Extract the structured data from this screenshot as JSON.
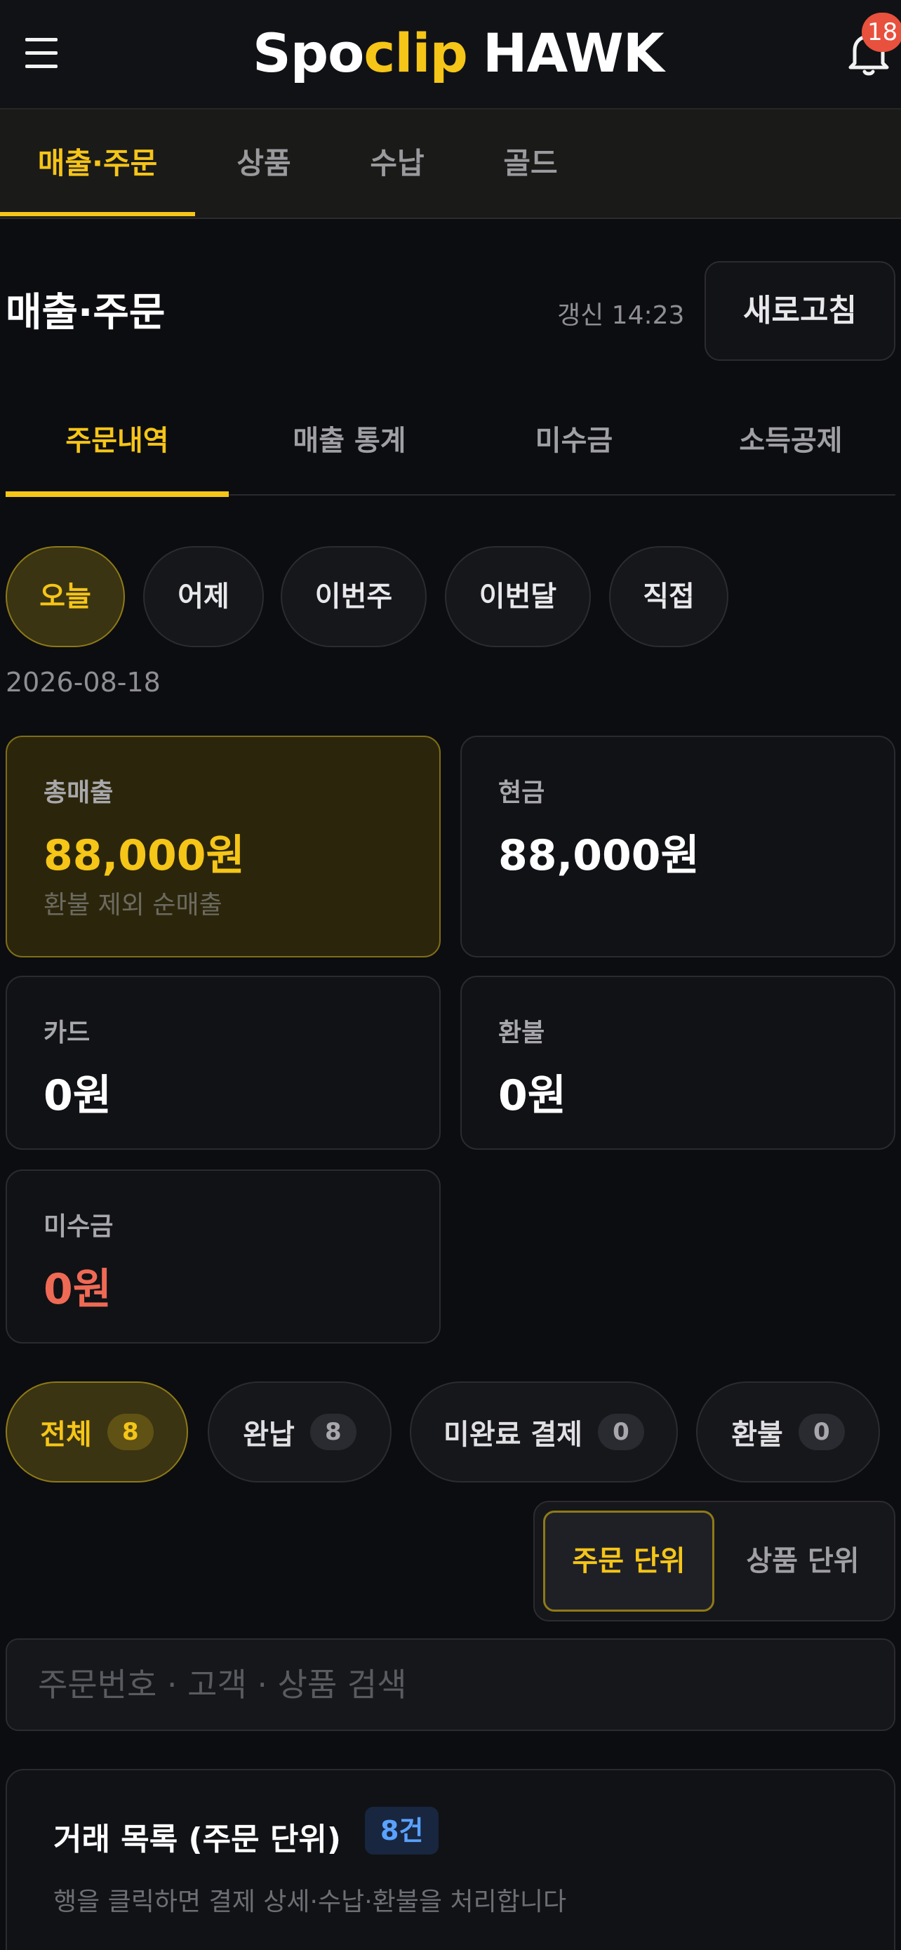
{
  "header": {
    "logo_part1": "Spo",
    "logo_part2": "clip",
    "logo_part3": "HAWK",
    "notification_count": "18"
  },
  "main_tabs": [
    "매출·주문",
    "상품",
    "수납",
    "골드"
  ],
  "section": {
    "title": "매출·주문",
    "updated": "갱신 14:23",
    "refresh_label": "새로고침"
  },
  "sub_tabs": [
    "주문내역",
    "매출 통계",
    "미수금",
    "소득공제"
  ],
  "periods": [
    "오늘",
    "어제",
    "이번주",
    "이번달",
    "직접"
  ],
  "selected_date": "2026-08-18",
  "stats": {
    "total": {
      "label": "총매출",
      "value": "88,000원",
      "sub": "환불 제외 순매출"
    },
    "cash": {
      "label": "현금",
      "value": "88,000원"
    },
    "card": {
      "label": "카드",
      "value": "0원"
    },
    "refund": {
      "label": "환불",
      "value": "0원"
    },
    "receivable": {
      "label": "미수금",
      "value": "0원"
    }
  },
  "filters": [
    {
      "label": "전체",
      "count": "8"
    },
    {
      "label": "완납",
      "count": "8"
    },
    {
      "label": "미완료 결제",
      "count": "0"
    },
    {
      "label": "환불",
      "count": "0"
    }
  ],
  "view_mode": {
    "order": "주문 단위",
    "product": "상품 단위"
  },
  "search": {
    "placeholder": "주문번호 · 고객 · 상품 검색"
  },
  "transactions": {
    "title": "거래 목록 (주문 단위)",
    "count": "8건",
    "hint": "행을 클릭하면 결제 상세·수납·환불을 처리합니다"
  },
  "colors": {
    "accent": "#f5c518",
    "background": "#0c0d10",
    "danger": "#ef6a55",
    "info": "#5aa2ff"
  }
}
